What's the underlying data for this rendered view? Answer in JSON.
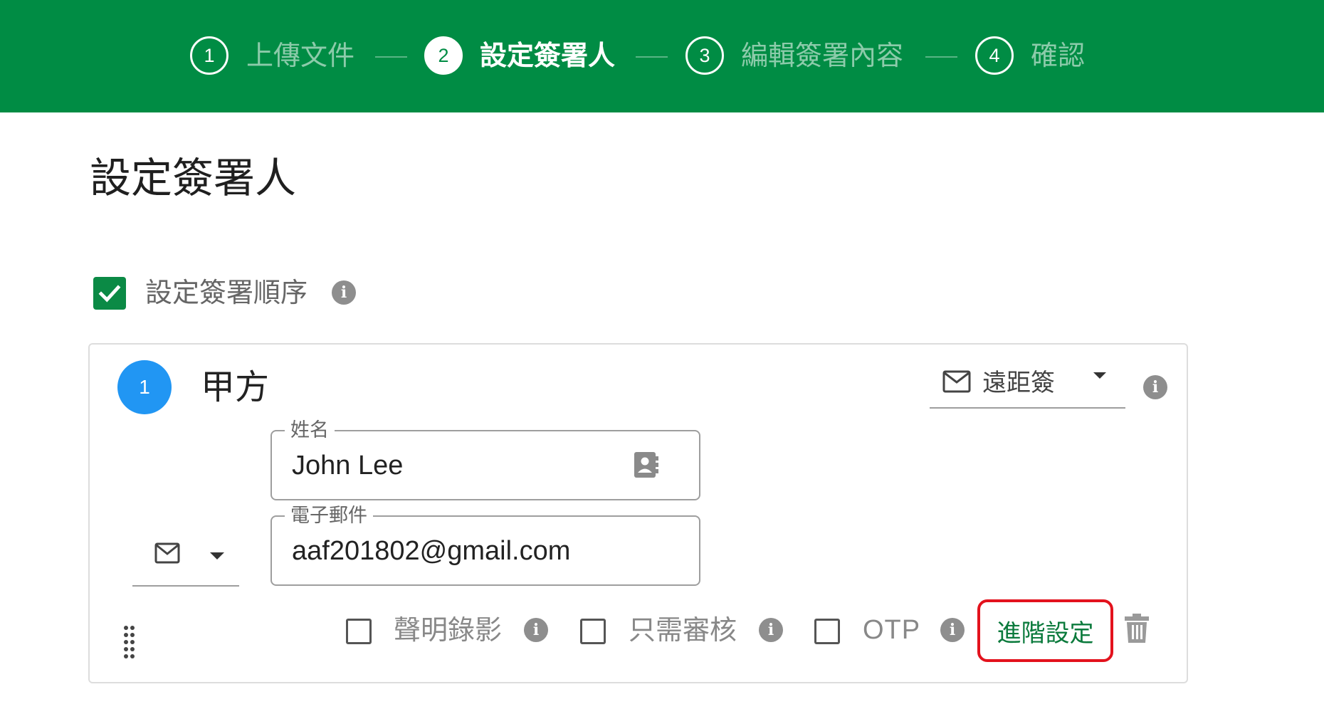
{
  "stepper": {
    "steps": [
      {
        "number": "1",
        "label": "上傳文件",
        "state": "inactive"
      },
      {
        "number": "2",
        "label": "設定簽署人",
        "state": "active"
      },
      {
        "number": "3",
        "label": "編輯簽署內容",
        "state": "inactive"
      },
      {
        "number": "4",
        "label": "確認",
        "state": "inactive"
      }
    ]
  },
  "page": {
    "title": "設定簽署人"
  },
  "signing_order": {
    "label": "設定簽署順序",
    "checked": true,
    "info_icon": "info-icon"
  },
  "signer": {
    "order": "1",
    "party": "甲方",
    "sign_type": {
      "value": "遠距簽",
      "icon": "mail-icon",
      "dropdown_icon": "caret-down-icon"
    },
    "name_field": {
      "label": "姓名",
      "value": "John Lee",
      "icon": "contact-book-icon"
    },
    "email_field": {
      "label": "電子郵件",
      "value": "aaf201802@gmail.com"
    },
    "notify_method": {
      "icon": "mail-icon",
      "dropdown_icon": "caret-down-icon"
    },
    "options": [
      {
        "label": "聲明錄影",
        "checked": false
      },
      {
        "label": "只需審核",
        "checked": false
      },
      {
        "label": "OTP",
        "checked": false
      }
    ],
    "advanced_button": "進階設定",
    "delete_icon": "trash-icon",
    "drag_handle_icon": "drag-handle-icon"
  },
  "colors": {
    "header_green": "#008c44",
    "checkbox_green": "#0b8a45",
    "order_badge_blue": "#2196f3",
    "highlight_red": "#e3121d"
  }
}
